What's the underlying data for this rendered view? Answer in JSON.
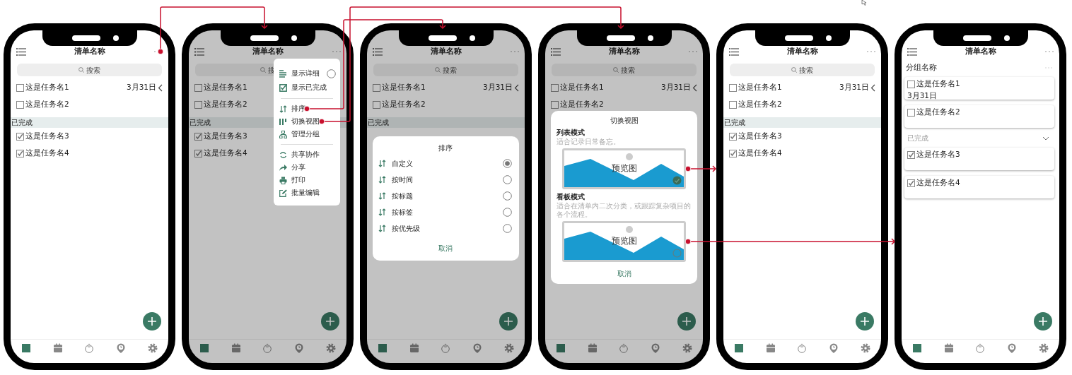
{
  "screens": [
    {
      "dimmed": false,
      "title": "清单名称",
      "search": {
        "placeholder": "搜索"
      },
      "open_tasks": [
        {
          "name": "这是任务名1",
          "checked": false,
          "date": "3月31日"
        },
        {
          "name": "这是任务名2",
          "checked": false
        }
      ],
      "completed_label": "已完成",
      "done_tasks": [
        {
          "name": "这是任务名3",
          "checked": true
        },
        {
          "name": "这是任务名4",
          "checked": true
        }
      ],
      "nav": [
        {
          "selected": true
        },
        {
          "selected": false
        },
        {
          "selected": false
        },
        {
          "selected": false
        },
        {
          "selected": false
        }
      ]
    },
    {
      "dimmed": true,
      "title": "清单名称",
      "search": {
        "placeholder": "搜"
      },
      "open_tasks": [
        {
          "name": "这是任务名1",
          "checked": false
        },
        {
          "name": "这是任务名2",
          "checked": false
        }
      ],
      "completed_label": "已完成",
      "done_tasks": [
        {
          "name": "这是任务名3",
          "checked": true
        },
        {
          "name": "这是任务名4",
          "checked": true
        }
      ],
      "nav": [
        {
          "selected": true
        },
        {
          "selected": false
        },
        {
          "selected": false
        },
        {
          "selected": false
        },
        {
          "selected": false
        }
      ],
      "menu": {
        "sections": [
          [
            {
              "kind": "toggle",
              "label": "显示详细",
              "on": false
            },
            {
              "kind": "action",
              "label": "显示已完成"
            }
          ],
          [
            {
              "kind": "action",
              "label": "排序"
            },
            {
              "kind": "action",
              "label": "切换视图"
            },
            {
              "kind": "action",
              "label": "管理分组"
            }
          ],
          [
            {
              "kind": "action",
              "label": "共享协作"
            },
            {
              "kind": "action",
              "label": "分享"
            },
            {
              "kind": "action",
              "label": "打印"
            },
            {
              "kind": "action",
              "label": "批量编辑"
            }
          ]
        ]
      }
    },
    {
      "dimmed": true,
      "title": "清单名称",
      "search": {
        "placeholder": "搜索"
      },
      "open_tasks": [
        {
          "name": "这是任务名1",
          "checked": false,
          "date": "3月31日"
        },
        {
          "name": "这是任务名2",
          "checked": false
        }
      ],
      "completed_label": "已完成",
      "nav": [
        {
          "selected": true
        },
        {
          "selected": false
        },
        {
          "selected": false
        },
        {
          "selected": false
        },
        {
          "selected": false
        }
      ],
      "sort_dialog": {
        "title": "排序",
        "options": [
          {
            "label": "自定义",
            "selected": true
          },
          {
            "label": "按时间",
            "selected": false
          },
          {
            "label": "按标题",
            "selected": false
          },
          {
            "label": "按标签",
            "selected": false
          },
          {
            "label": "按优先级",
            "selected": false
          }
        ],
        "cancel": "取消"
      }
    },
    {
      "dimmed": true,
      "title": "清单名称",
      "search": {
        "placeholder": "搜索"
      },
      "open_tasks": [
        {
          "name": "这是任务名1",
          "checked": false,
          "date": "3月31日"
        },
        {
          "name": "这是任务名2",
          "checked": false
        }
      ],
      "nav": [
        {
          "selected": true
        },
        {
          "selected": false
        },
        {
          "selected": false
        },
        {
          "selected": false
        },
        {
          "selected": false
        }
      ],
      "view_dialog": {
        "title": "切换视图",
        "modes": [
          {
            "title": "列表模式",
            "description": "适合记录日常备忘。",
            "preview_label": "预览图",
            "selected": true
          },
          {
            "title": "看板模式",
            "description": "适合在清单内二次分类，或跟踪复杂项目的各个流程。",
            "preview_label": "预览图",
            "selected": false
          }
        ],
        "cancel": "取消"
      }
    },
    {
      "dimmed": false,
      "title": "清单名称",
      "search": {
        "placeholder": "搜索"
      },
      "open_tasks": [
        {
          "name": "这是任务名1",
          "checked": false,
          "date": "3月31日"
        },
        {
          "name": "这是任务名2",
          "checked": false
        }
      ],
      "completed_label": "已完成",
      "done_tasks": [
        {
          "name": "这是任务名3",
          "checked": true
        },
        {
          "name": "这是任务名4",
          "checked": true
        }
      ],
      "nav": [
        {
          "selected": true
        },
        {
          "selected": false
        },
        {
          "selected": false
        },
        {
          "selected": false
        },
        {
          "selected": false
        }
      ]
    },
    {
      "dimmed": false,
      "title": "清单名称",
      "group_name": "分组名称",
      "open_tasks": [
        {
          "name": "这是任务名1",
          "checked": false,
          "date": "3月31日"
        },
        {
          "name": "这是任务名2",
          "checked": false
        }
      ],
      "completed_label": "已完成",
      "done_tasks": [
        {
          "name": "这是任务名3",
          "checked": true
        },
        {
          "name": "这是任务名4",
          "checked": true
        }
      ],
      "nav": [
        {
          "selected": true
        },
        {
          "selected": false
        },
        {
          "selected": false
        },
        {
          "selected": false
        },
        {
          "selected": false
        }
      ]
    }
  ]
}
